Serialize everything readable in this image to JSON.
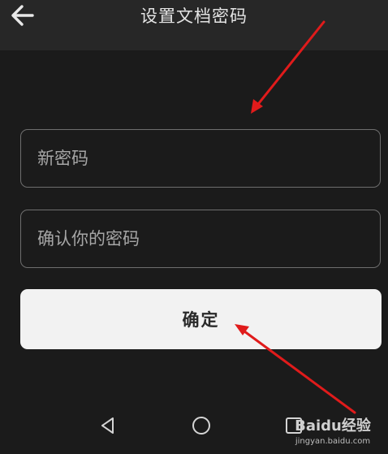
{
  "header": {
    "title": "设置文档密码",
    "back_icon": "arrow-left-icon"
  },
  "form": {
    "new_password_placeholder": "新密码",
    "confirm_password_placeholder": "确认你的密码",
    "submit_label": "确定"
  },
  "system_nav": {
    "back_icon": "triangle-back-icon",
    "home_icon": "circle-home-icon",
    "recent_icon": "square-recent-icon"
  },
  "watermark": {
    "logo_text": "Baidu经验",
    "url": "jingyan.baidu.com"
  },
  "colors": {
    "background": "#1b1b1b",
    "app_bar": "#272727",
    "button_bg": "#f2f2f2",
    "annotation_arrow": "#e01b1b"
  }
}
